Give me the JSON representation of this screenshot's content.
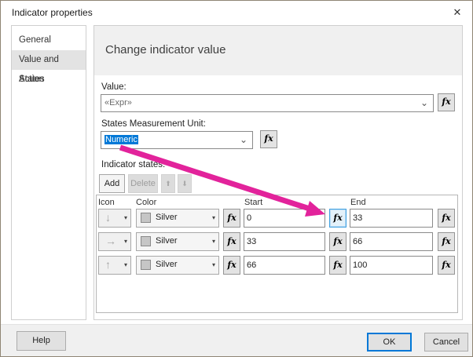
{
  "window": {
    "title": "Indicator properties"
  },
  "icons": {
    "close": "✕",
    "fx": "fx",
    "chevron_down": "⌄",
    "dropdown_arrow": "▾",
    "arrow_down": "↓",
    "arrow_right": "→",
    "arrow_up": "↑",
    "move_up": "⬆",
    "move_down": "⬇"
  },
  "sidebar": {
    "items": [
      {
        "label": "General",
        "selected": false
      },
      {
        "label": "Value and States",
        "selected": true
      },
      {
        "label": "Action",
        "selected": false
      }
    ]
  },
  "main": {
    "heading": "Change indicator value",
    "value_field": {
      "label": "Value:",
      "value": "«Expr»"
    },
    "unit_field": {
      "label": "States Measurement Unit:",
      "value": "Numeric"
    },
    "states": {
      "label": "Indicator states:",
      "add_label": "Add",
      "delete_label": "Delete",
      "table": {
        "headers": [
          "Icon",
          "Color",
          "Start",
          "End"
        ],
        "rows": [
          {
            "icon": "arrow-down",
            "color": "Silver",
            "start": "0",
            "end": "33",
            "start_fx_highlighted": true
          },
          {
            "icon": "arrow-right",
            "color": "Silver",
            "start": "33",
            "end": "66",
            "start_fx_highlighted": false
          },
          {
            "icon": "arrow-up",
            "color": "Silver",
            "start": "66",
            "end": "100",
            "start_fx_highlighted": false
          }
        ]
      }
    }
  },
  "footer": {
    "help": "Help",
    "ok": "OK",
    "cancel": "Cancel"
  },
  "colors": {
    "selection_blue": "#0078d7",
    "annotation_arrow": "#e2239b",
    "silver_swatch": "#c6c6c6",
    "fx_highlight_border": "#41a1e0"
  }
}
